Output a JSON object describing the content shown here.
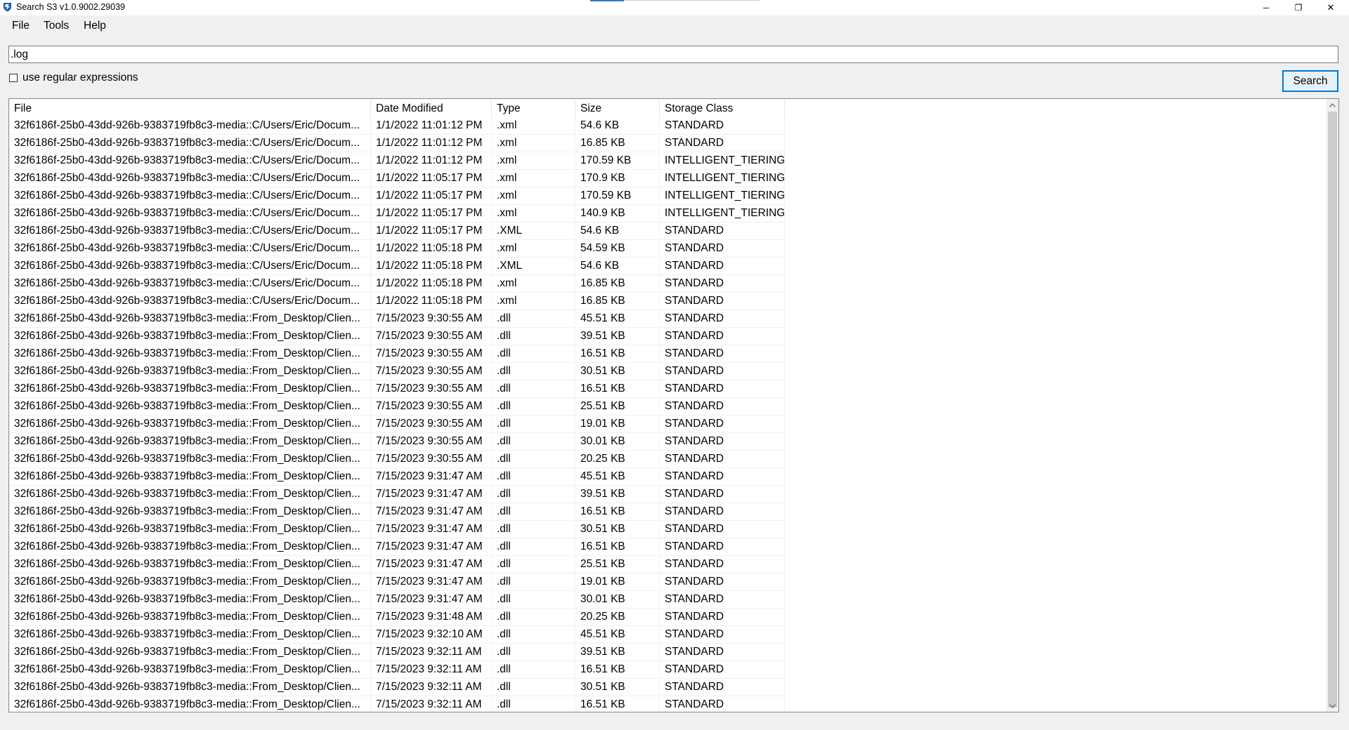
{
  "window": {
    "title": "Search S3 v1.0.9002.29039",
    "minimize_glyph": "─",
    "maximize_glyph": "❐",
    "close_glyph": "✕"
  },
  "menu": [
    "File",
    "Tools",
    "Help"
  ],
  "search": {
    "value": ".log",
    "regex_label": "use regular expressions",
    "regex_checked": false,
    "button_label": "Search"
  },
  "colors": {
    "accent": "#0078d7",
    "app_icon": "#1f5fa8"
  },
  "table": {
    "columns": [
      "File",
      "Date Modified",
      "Type",
      "Size",
      "Storage Class"
    ],
    "rows": [
      [
        "32f6186f-25b0-43dd-926b-9383719fb8c3-media::C/Users/Eric/Docum...",
        "1/1/2022 11:01:12 PM",
        ".xml",
        "54.6 KB",
        "STANDARD"
      ],
      [
        "32f6186f-25b0-43dd-926b-9383719fb8c3-media::C/Users/Eric/Docum...",
        "1/1/2022 11:01:12 PM",
        ".xml",
        "16.85 KB",
        "STANDARD"
      ],
      [
        "32f6186f-25b0-43dd-926b-9383719fb8c3-media::C/Users/Eric/Docum...",
        "1/1/2022 11:01:12 PM",
        ".xml",
        "170.59 KB",
        "INTELLIGENT_TIERING"
      ],
      [
        "32f6186f-25b0-43dd-926b-9383719fb8c3-media::C/Users/Eric/Docum...",
        "1/1/2022 11:05:17 PM",
        ".xml",
        "170.9 KB",
        "INTELLIGENT_TIERING"
      ],
      [
        "32f6186f-25b0-43dd-926b-9383719fb8c3-media::C/Users/Eric/Docum...",
        "1/1/2022 11:05:17 PM",
        ".xml",
        "170.59 KB",
        "INTELLIGENT_TIERING"
      ],
      [
        "32f6186f-25b0-43dd-926b-9383719fb8c3-media::C/Users/Eric/Docum...",
        "1/1/2022 11:05:17 PM",
        ".xml",
        "140.9 KB",
        "INTELLIGENT_TIERING"
      ],
      [
        "32f6186f-25b0-43dd-926b-9383719fb8c3-media::C/Users/Eric/Docum...",
        "1/1/2022 11:05:17 PM",
        ".XML",
        "54.6 KB",
        "STANDARD"
      ],
      [
        "32f6186f-25b0-43dd-926b-9383719fb8c3-media::C/Users/Eric/Docum...",
        "1/1/2022 11:05:18 PM",
        ".xml",
        "54.59 KB",
        "STANDARD"
      ],
      [
        "32f6186f-25b0-43dd-926b-9383719fb8c3-media::C/Users/Eric/Docum...",
        "1/1/2022 11:05:18 PM",
        ".XML",
        "54.6 KB",
        "STANDARD"
      ],
      [
        "32f6186f-25b0-43dd-926b-9383719fb8c3-media::C/Users/Eric/Docum...",
        "1/1/2022 11:05:18 PM",
        ".xml",
        "16.85 KB",
        "STANDARD"
      ],
      [
        "32f6186f-25b0-43dd-926b-9383719fb8c3-media::C/Users/Eric/Docum...",
        "1/1/2022 11:05:18 PM",
        ".xml",
        "16.85 KB",
        "STANDARD"
      ],
      [
        "32f6186f-25b0-43dd-926b-9383719fb8c3-media::From_Desktop/Clien...",
        "7/15/2023 9:30:55 AM",
        ".dll",
        "45.51 KB",
        "STANDARD"
      ],
      [
        "32f6186f-25b0-43dd-926b-9383719fb8c3-media::From_Desktop/Clien...",
        "7/15/2023 9:30:55 AM",
        ".dll",
        "39.51 KB",
        "STANDARD"
      ],
      [
        "32f6186f-25b0-43dd-926b-9383719fb8c3-media::From_Desktop/Clien...",
        "7/15/2023 9:30:55 AM",
        ".dll",
        "16.51 KB",
        "STANDARD"
      ],
      [
        "32f6186f-25b0-43dd-926b-9383719fb8c3-media::From_Desktop/Clien...",
        "7/15/2023 9:30:55 AM",
        ".dll",
        "30.51 KB",
        "STANDARD"
      ],
      [
        "32f6186f-25b0-43dd-926b-9383719fb8c3-media::From_Desktop/Clien...",
        "7/15/2023 9:30:55 AM",
        ".dll",
        "16.51 KB",
        "STANDARD"
      ],
      [
        "32f6186f-25b0-43dd-926b-9383719fb8c3-media::From_Desktop/Clien...",
        "7/15/2023 9:30:55 AM",
        ".dll",
        "25.51 KB",
        "STANDARD"
      ],
      [
        "32f6186f-25b0-43dd-926b-9383719fb8c3-media::From_Desktop/Clien...",
        "7/15/2023 9:30:55 AM",
        ".dll",
        "19.01 KB",
        "STANDARD"
      ],
      [
        "32f6186f-25b0-43dd-926b-9383719fb8c3-media::From_Desktop/Clien...",
        "7/15/2023 9:30:55 AM",
        ".dll",
        "30.01 KB",
        "STANDARD"
      ],
      [
        "32f6186f-25b0-43dd-926b-9383719fb8c3-media::From_Desktop/Clien...",
        "7/15/2023 9:30:55 AM",
        ".dll",
        "20.25 KB",
        "STANDARD"
      ],
      [
        "32f6186f-25b0-43dd-926b-9383719fb8c3-media::From_Desktop/Clien...",
        "7/15/2023 9:31:47 AM",
        ".dll",
        "45.51 KB",
        "STANDARD"
      ],
      [
        "32f6186f-25b0-43dd-926b-9383719fb8c3-media::From_Desktop/Clien...",
        "7/15/2023 9:31:47 AM",
        ".dll",
        "39.51 KB",
        "STANDARD"
      ],
      [
        "32f6186f-25b0-43dd-926b-9383719fb8c3-media::From_Desktop/Clien...",
        "7/15/2023 9:31:47 AM",
        ".dll",
        "16.51 KB",
        "STANDARD"
      ],
      [
        "32f6186f-25b0-43dd-926b-9383719fb8c3-media::From_Desktop/Clien...",
        "7/15/2023 9:31:47 AM",
        ".dll",
        "30.51 KB",
        "STANDARD"
      ],
      [
        "32f6186f-25b0-43dd-926b-9383719fb8c3-media::From_Desktop/Clien...",
        "7/15/2023 9:31:47 AM",
        ".dll",
        "16.51 KB",
        "STANDARD"
      ],
      [
        "32f6186f-25b0-43dd-926b-9383719fb8c3-media::From_Desktop/Clien...",
        "7/15/2023 9:31:47 AM",
        ".dll",
        "25.51 KB",
        "STANDARD"
      ],
      [
        "32f6186f-25b0-43dd-926b-9383719fb8c3-media::From_Desktop/Clien...",
        "7/15/2023 9:31:47 AM",
        ".dll",
        "19.01 KB",
        "STANDARD"
      ],
      [
        "32f6186f-25b0-43dd-926b-9383719fb8c3-media::From_Desktop/Clien...",
        "7/15/2023 9:31:47 AM",
        ".dll",
        "30.01 KB",
        "STANDARD"
      ],
      [
        "32f6186f-25b0-43dd-926b-9383719fb8c3-media::From_Desktop/Clien...",
        "7/15/2023 9:31:48 AM",
        ".dll",
        "20.25 KB",
        "STANDARD"
      ],
      [
        "32f6186f-25b0-43dd-926b-9383719fb8c3-media::From_Desktop/Clien...",
        "7/15/2023 9:32:10 AM",
        ".dll",
        "45.51 KB",
        "STANDARD"
      ],
      [
        "32f6186f-25b0-43dd-926b-9383719fb8c3-media::From_Desktop/Clien...",
        "7/15/2023 9:32:11 AM",
        ".dll",
        "39.51 KB",
        "STANDARD"
      ],
      [
        "32f6186f-25b0-43dd-926b-9383719fb8c3-media::From_Desktop/Clien...",
        "7/15/2023 9:32:11 AM",
        ".dll",
        "16.51 KB",
        "STANDARD"
      ],
      [
        "32f6186f-25b0-43dd-926b-9383719fb8c3-media::From_Desktop/Clien...",
        "7/15/2023 9:32:11 AM",
        ".dll",
        "30.51 KB",
        "STANDARD"
      ],
      [
        "32f6186f-25b0-43dd-926b-9383719fb8c3-media::From_Desktop/Clien...",
        "7/15/2023 9:32:11 AM",
        ".dll",
        "16.51 KB",
        "STANDARD"
      ]
    ]
  }
}
